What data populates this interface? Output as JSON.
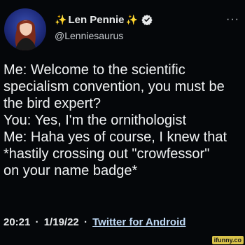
{
  "author": {
    "display_name": "Len Pennie",
    "name_emoji": "✨",
    "handle": "@Lenniesaurus",
    "verified": true,
    "avatar_icon": "profile-photo"
  },
  "menu": {
    "more_label": "···"
  },
  "tweet": {
    "lines": [
      "Me: Welcome to the scientific",
      "specialism convention, you must be",
      "the bird expert?",
      "You: Yes, I'm the ornithologist",
      "Me: Haha yes of course, I knew that",
      "*hastily crossing out \"crowfessor\"",
      "on your name badge*"
    ]
  },
  "footer": {
    "time": "20:21",
    "separator": "·",
    "date": "1/19/22",
    "source": "Twitter for Android"
  },
  "watermark": {
    "text": "ifunny.co"
  },
  "colors": {
    "background": "#05070a",
    "text": "#e7e9ea",
    "verified_badge": "#e7e9ea",
    "sparkle": "#f7c948",
    "source_link": "#bfd9f5"
  }
}
